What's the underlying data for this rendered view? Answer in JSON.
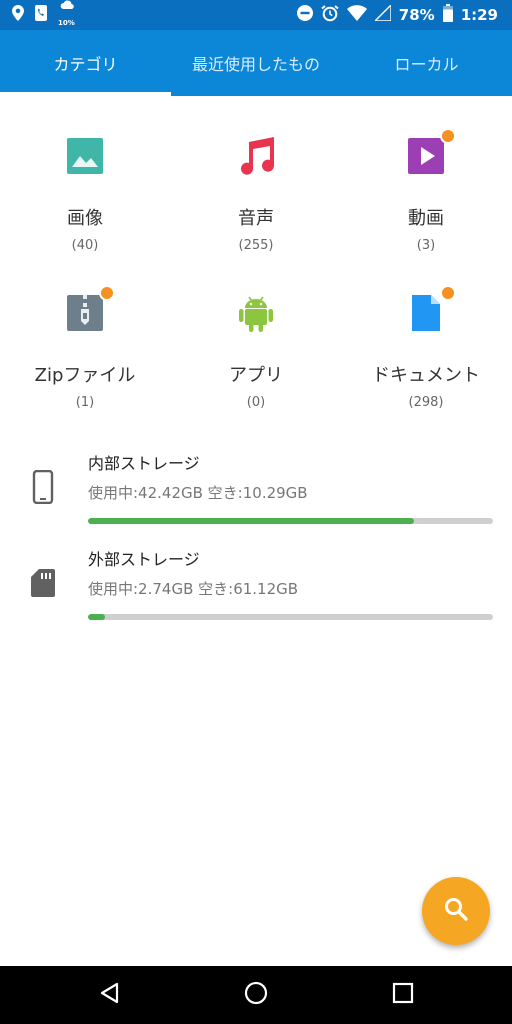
{
  "status_bar": {
    "weather_text": "10%",
    "battery_text": "78%",
    "time": "1:29",
    "icons": [
      "location-icon",
      "phone-icon",
      "weather-icon",
      "dnd-icon",
      "alarm-icon",
      "wifi-icon",
      "signal-icon",
      "battery-icon"
    ]
  },
  "tabs": [
    {
      "label": "カテゴリ",
      "active": true
    },
    {
      "label": "最近使用したもの",
      "active": false
    },
    {
      "label": "ローカル",
      "active": false
    }
  ],
  "categories": [
    {
      "label": "画像",
      "count": "(40)",
      "icon": "image-icon",
      "color": "#3fb6a8",
      "badge": false
    },
    {
      "label": "音声",
      "count": "(255)",
      "icon": "music-icon",
      "color": "#e8344f",
      "badge": false
    },
    {
      "label": "動画",
      "count": "(3)",
      "icon": "video-icon",
      "color": "#9c3fb4",
      "badge": true
    },
    {
      "label": "Zipファイル",
      "count": "(1)",
      "icon": "zip-icon",
      "color": "#6e7f8c",
      "badge": true
    },
    {
      "label": "アプリ",
      "count": "(0)",
      "icon": "android-icon",
      "color": "#8cc63f",
      "badge": false
    },
    {
      "label": "ドキュメント",
      "count": "(298)",
      "icon": "document-icon",
      "color": "#2196f3",
      "badge": true
    }
  ],
  "storage": [
    {
      "title": "内部ストレージ",
      "detail": "使用中:42.42GB 空き:10.29GB",
      "used_fraction": 0.805,
      "icon": "phone-device-icon"
    },
    {
      "title": "外部ストレージ",
      "detail": "使用中:2.74GB 空き:61.12GB",
      "used_fraction": 0.043,
      "icon": "sd-card-icon"
    }
  ],
  "colors": {
    "status_bar": "#0a6fbf",
    "app_bar": "#0c86d6",
    "accent": "#f5a623",
    "progress": "#4caf50"
  },
  "fab": {
    "icon": "search-icon"
  },
  "nav": [
    "back-icon",
    "home-icon",
    "recents-icon"
  ]
}
